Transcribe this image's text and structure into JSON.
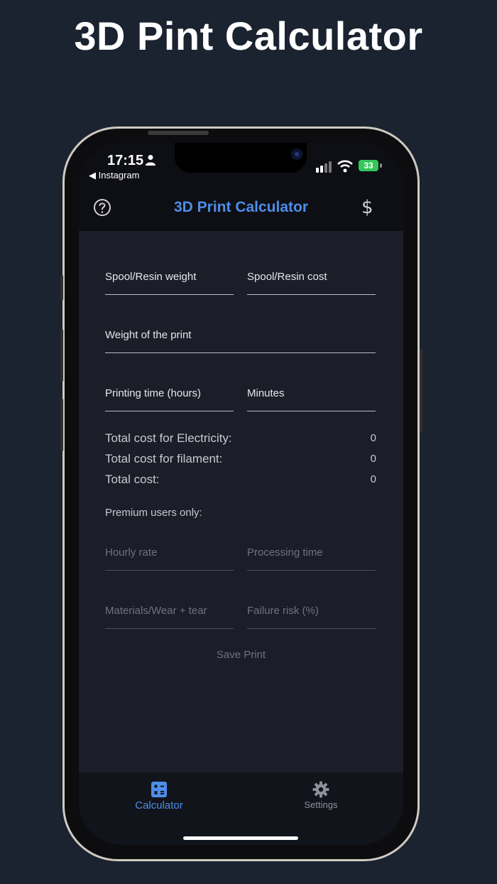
{
  "promo": {
    "title": "3D Pint Calculator"
  },
  "status": {
    "time": "17:15",
    "back_app": "◀ Instagram",
    "battery": "33"
  },
  "header": {
    "title": "3D Print Calculator",
    "help_icon": "question-circle-icon",
    "currency_icon": "$"
  },
  "fields": {
    "spool_weight": "Spool/Resin weight",
    "spool_cost": "Spool/Resin cost",
    "print_weight": "Weight of the print",
    "print_hours": "Printing time (hours)",
    "minutes": "Minutes"
  },
  "totals": [
    {
      "label": "Total cost for Electricity:",
      "value": "0"
    },
    {
      "label": "Total cost for filament:",
      "value": "0"
    },
    {
      "label": "Total cost:",
      "value": "0"
    }
  ],
  "premium": {
    "heading": "Premium users only:",
    "hourly_rate": "Hourly rate",
    "processing_time": "Processing time",
    "materials": "Materials/Wear + tear",
    "failure_risk": "Failure risk (%)"
  },
  "save_label": "Save Print",
  "tabs": [
    {
      "label": "Calculator",
      "icon": "calculator-icon",
      "active": true
    },
    {
      "label": "Settings",
      "icon": "gear-icon",
      "active": false
    }
  ],
  "colors": {
    "accent": "#4d8ee8",
    "background": "#1b2230",
    "battery": "#34c759"
  }
}
